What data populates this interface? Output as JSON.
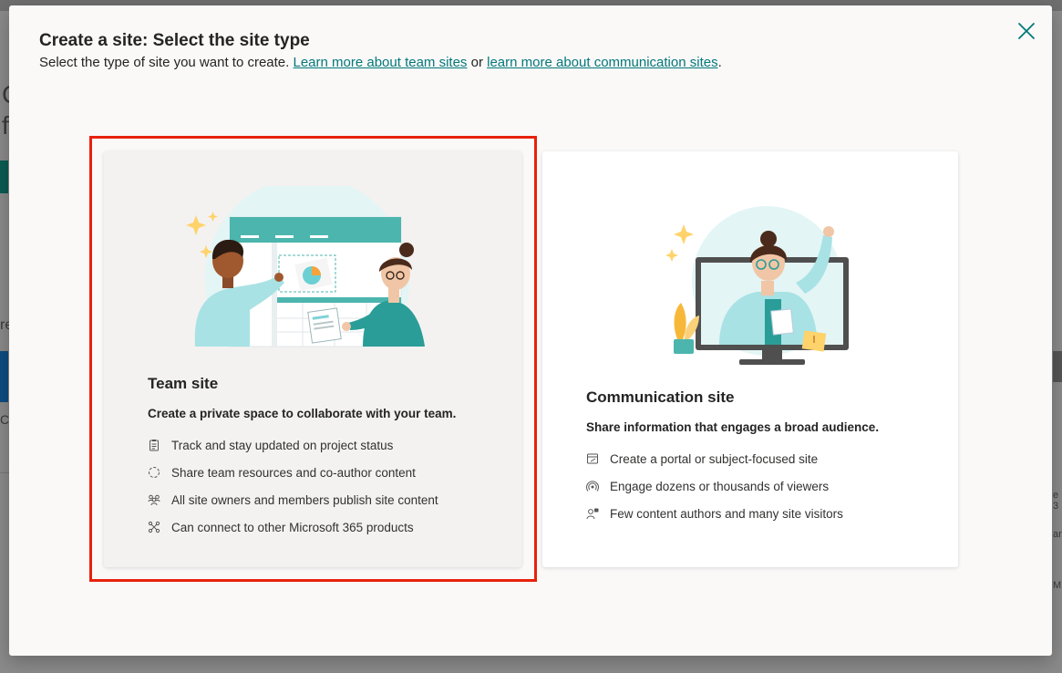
{
  "background": {
    "fragments": [
      "C",
      "f",
      "re",
      "Cc",
      "e 3",
      "an",
      "M"
    ]
  },
  "dialog": {
    "title": "Create a site: Select the site type",
    "subtitle_prefix": "Select the type of site you want to create. ",
    "link_team": "Learn more about team sites",
    "subtitle_or": " or ",
    "link_comm": "learn more about communication sites",
    "subtitle_suffix": ".",
    "close_icon": "close-icon"
  },
  "team_site": {
    "title": "Team site",
    "description": "Create a private space to collaborate with your team.",
    "features": [
      {
        "icon": "clipboard-list-icon",
        "label": "Track and stay updated on project status"
      },
      {
        "icon": "sync-circle-icon",
        "label": "Share team resources and co-author content"
      },
      {
        "icon": "people-team-icon",
        "label": "All site owners and members publish site content"
      },
      {
        "icon": "connector-icon",
        "label": "Can connect to other Microsoft 365 products"
      }
    ],
    "selected": true
  },
  "communication_site": {
    "title": "Communication site",
    "description": "Share information that engages a broad audience.",
    "features": [
      {
        "icon": "notepad-edit-icon",
        "label": "Create a portal or subject-focused site"
      },
      {
        "icon": "broadcast-icon",
        "label": "Engage dozens or thousands of viewers"
      },
      {
        "icon": "person-feedback-icon",
        "label": "Few content authors and many site visitors"
      }
    ]
  },
  "colors": {
    "accent_link": "#03787c",
    "selection_outline": "#e8210b",
    "teal": "#4cb5ae",
    "light_cyan": "#a8e2e4"
  }
}
